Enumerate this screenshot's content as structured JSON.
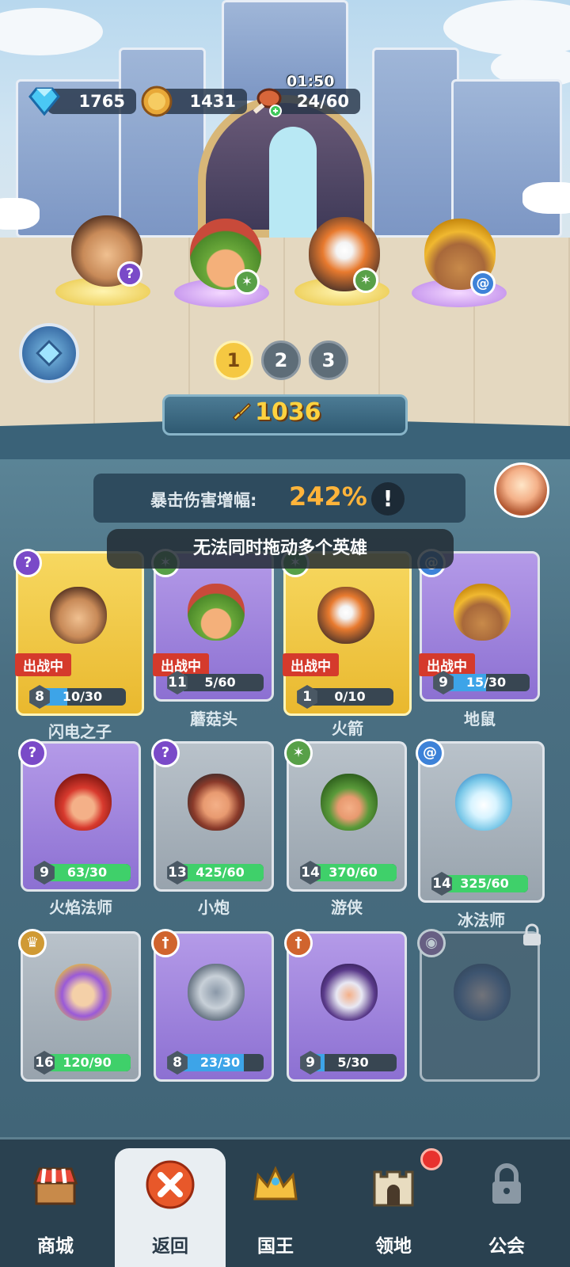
{
  "resources": {
    "gems": "1765",
    "gold": "1431",
    "stamina": "24/60",
    "timer": "01:50"
  },
  "pages": [
    "1",
    "2",
    "3"
  ],
  "power": "1036",
  "crit": {
    "label": "暴击伤害增幅:",
    "value": "242%",
    "info": "!"
  },
  "toast": "无法同时拖动多个英雄",
  "deployed_label": "出战中",
  "heroes": [
    {
      "name": "闪电之子",
      "level": "8",
      "progress": "10/30",
      "fill": 0.33,
      "type": "magic"
    },
    {
      "name": "蘑菇头",
      "level": "11",
      "progress": "5/60",
      "fill": 0.08,
      "type": "nature"
    },
    {
      "name": "火箭",
      "level": "1",
      "progress": "0/10",
      "fill": 0.0,
      "type": "nature"
    },
    {
      "name": "地鼠",
      "level": "9",
      "progress": "15/30",
      "fill": 0.5,
      "type": "ice"
    },
    {
      "name": "火焰法师",
      "level": "9",
      "progress": "63/30",
      "fill": 1.0,
      "type": "magic"
    },
    {
      "name": "小炮",
      "level": "13",
      "progress": "425/60",
      "fill": 1.0,
      "type": "magic"
    },
    {
      "name": "游侠",
      "level": "14",
      "progress": "370/60",
      "fill": 1.0,
      "type": "nature"
    },
    {
      "name": "冰法师",
      "level": "14",
      "progress": "325/60",
      "fill": 1.0,
      "type": "ice"
    },
    {
      "name": "",
      "level": "16",
      "progress": "120/90",
      "fill": 1.0,
      "type": "holy"
    },
    {
      "name": "",
      "level": "8",
      "progress": "23/30",
      "fill": 0.77,
      "type": "sword"
    },
    {
      "name": "",
      "level": "9",
      "progress": "5/30",
      "fill": 0.17,
      "type": "sword"
    }
  ],
  "nav": {
    "shop": "商城",
    "back": "返回",
    "king": "国王",
    "territory": "领地",
    "guild": "公会"
  },
  "colors": {
    "accent_gold": "#f5c842",
    "crit_orange": "#ffb43a",
    "deployed_red": "#d53a2c",
    "progress_green": "#3fd06a"
  }
}
